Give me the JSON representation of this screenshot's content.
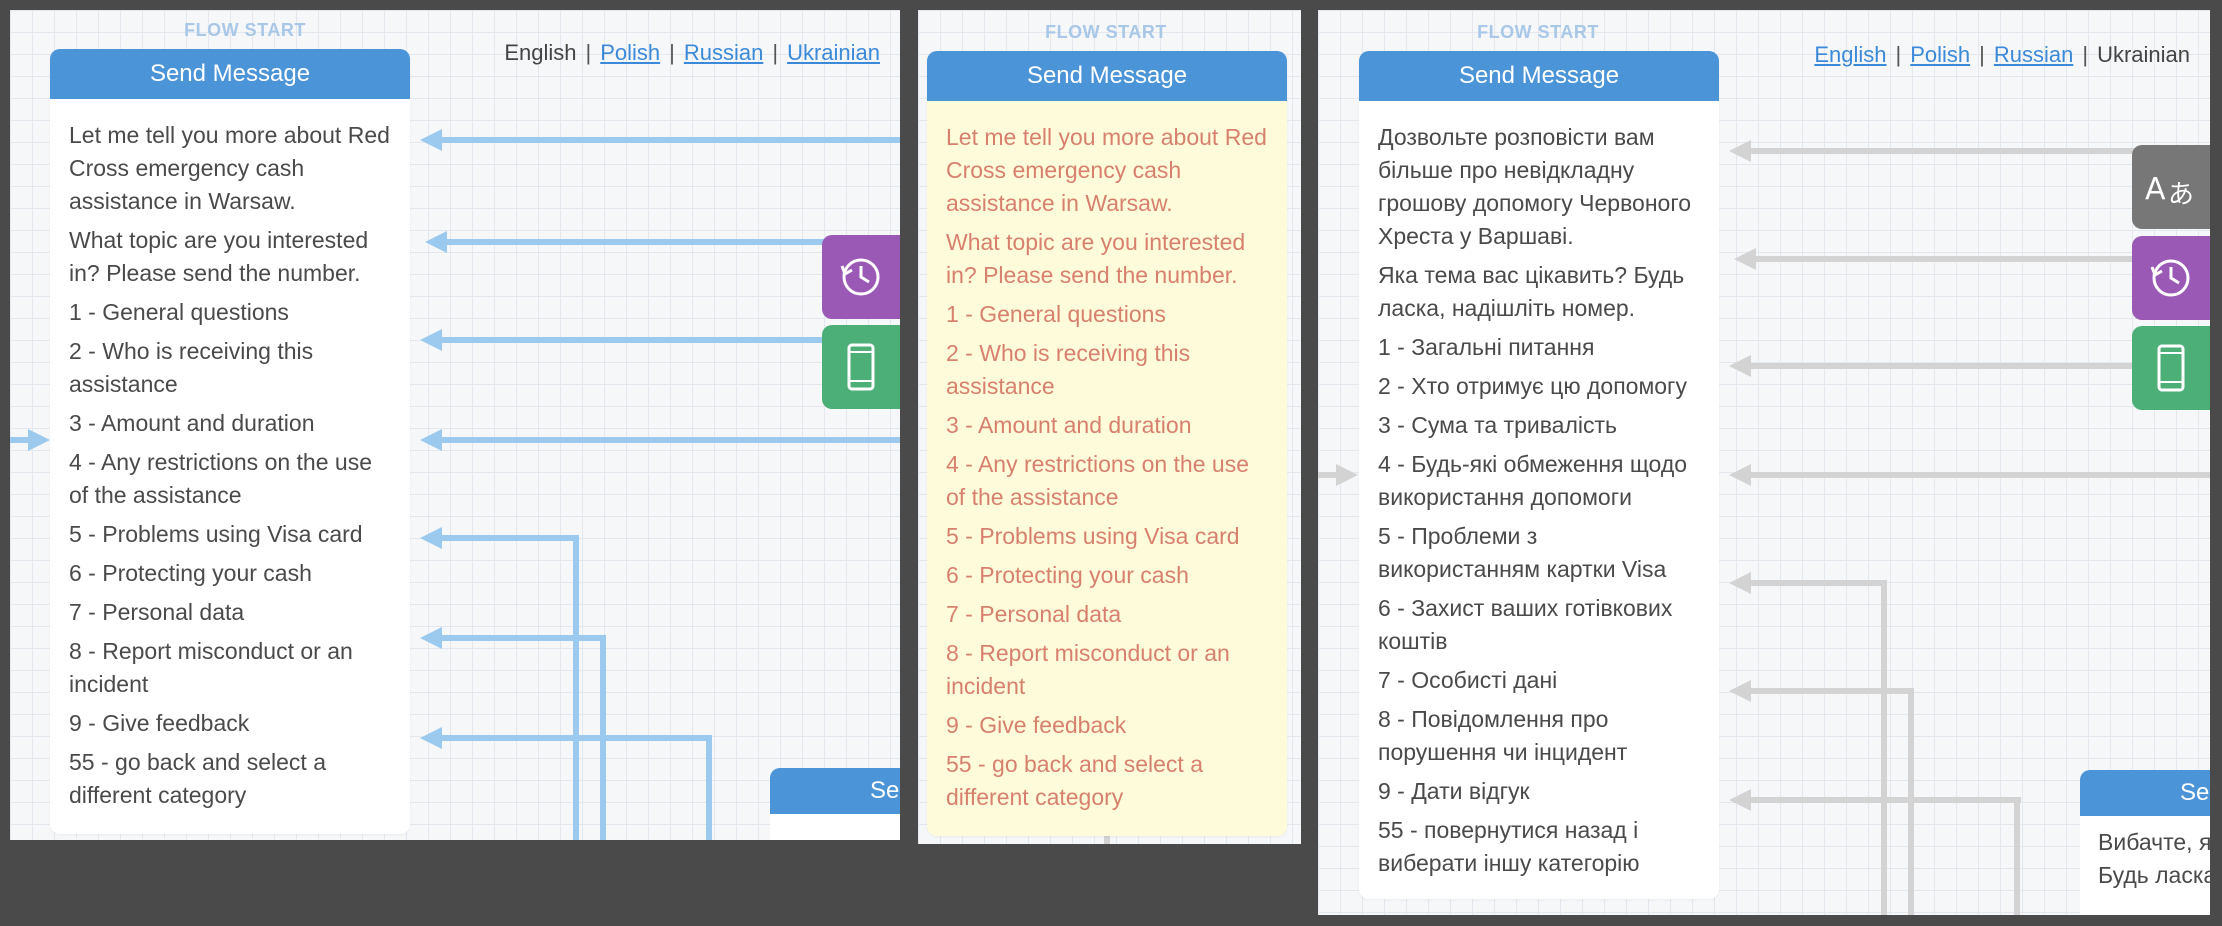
{
  "colors": {
    "accent": "#4b94d8",
    "arrow_blue": "#9ccaef",
    "arrow_grey": "#d3d3d3",
    "history": "#9b59b6",
    "device": "#4caf78",
    "translate": "#777777",
    "yellow_bg": "#fdfbd9",
    "yellow_text": "#d8806e"
  },
  "panel1": {
    "flow_start": "FLOW START",
    "languages": {
      "english": "English",
      "polish": "Polish",
      "russian": "Russian",
      "ukrainian": "Ukrainian"
    },
    "card_title": "Send Message",
    "lines": [
      "Let me tell you more about Red Cross emergency cash assistance in Warsaw.",
      "What topic are you interested in? Please send the number.",
      "1 - General questions",
      "2 - Who is receiving this assistance",
      "3 - Amount and duration",
      "4 - Any restrictions on the use of the assistance",
      "5 - Problems using Visa card",
      "6 - Protecting your cash",
      "7 - Personal data",
      "8 - Report misconduct or an incident",
      "9 - Give feedback",
      "55 - go back and select a different category"
    ],
    "partial_card_title": "Se"
  },
  "panel2": {
    "flow_start": "FLOW START",
    "card_title": "Send Message",
    "lines": [
      "Let me tell you more about Red Cross emergency cash assistance in Warsaw.",
      "What topic are you interested in? Please send the number.",
      "1 - General questions",
      "2 - Who is receiving this assistance",
      "3 - Amount and duration",
      "4 - Any restrictions on the use of the assistance",
      "5 - Problems using Visa card",
      "6 - Protecting your cash",
      "7 - Personal data",
      "8 - Report misconduct or an incident",
      "9 - Give feedback",
      "55 - go back and select a different category"
    ]
  },
  "panel3": {
    "flow_start": "FLOW START",
    "languages": {
      "english": "English",
      "polish": "Polish",
      "russian": "Russian",
      "ukrainian": "Ukrainian"
    },
    "card_title": "Send Message",
    "lines": [
      "Дозвольте розповісти вам більше про невідкладну грошову допомогу Червоного Хреста у Варшаві.",
      "Яка тема вас цікавить? Будь ласка, надішліть номер.",
      "1 - Загальні питання",
      "2 - Хто отримує цю допомогу",
      "3 - Сума та тривалість",
      "4 - Будь-які обмеження щодо використання допомоги",
      "5 - Проблеми з використанням картки Visa",
      "6 - Захист ваших готівкових коштів",
      "7 - Особисті дані",
      "8 - Повідомлення про порушення чи інцидент",
      "9 - Дати відгук",
      "55 - повернутися назад і виберати іншу категорію"
    ],
    "partial_card_title": "Se",
    "partial_card_lines": [
      "Вибачте, я",
      "Будь ласка"
    ]
  },
  "icons": {
    "translate": "translate-icon",
    "history": "history-icon",
    "device": "mobile-phone-icon"
  }
}
